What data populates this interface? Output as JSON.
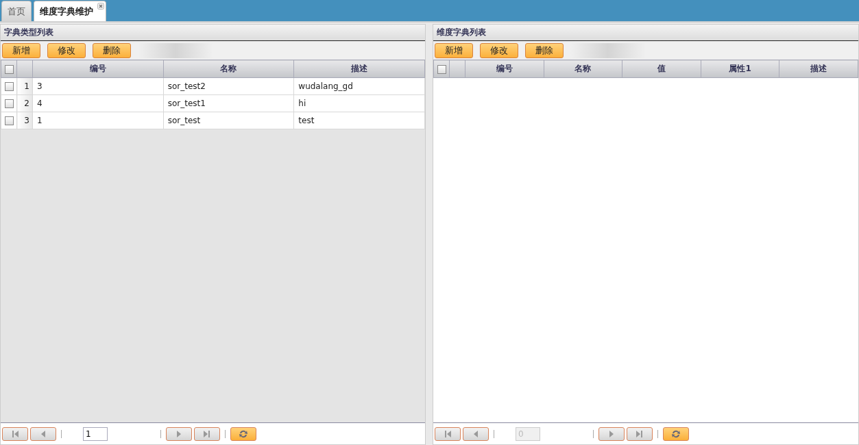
{
  "tabs": [
    {
      "label": "首页",
      "selected": false,
      "closable": false
    },
    {
      "label": "维度字典维护",
      "selected": true,
      "closable": true
    }
  ],
  "panels": [
    {
      "title": "字典类型列表",
      "buttons": [
        "新增",
        "修改",
        "删除"
      ],
      "columns": [
        "编号",
        "名称",
        "描述"
      ],
      "all_checked": false,
      "rows": [
        {
          "number": "1",
          "checked": false,
          "cells": [
            "3",
            "sor_test2",
            "wudalang_gd"
          ]
        },
        {
          "number": "2",
          "checked": false,
          "cells": [
            "4",
            "sor_test1",
            "hi"
          ]
        },
        {
          "number": "3",
          "checked": false,
          "cells": [
            "1",
            "sor_test",
            "test"
          ]
        }
      ],
      "pager": {
        "page": "1",
        "disabled": false
      }
    },
    {
      "title": "维度字典列表",
      "buttons": [
        "新增",
        "修改",
        "删除"
      ],
      "columns": [
        "编号",
        "名称",
        "值",
        "属性1",
        "描述"
      ],
      "all_checked": false,
      "pager": {
        "page": "0",
        "disabled": true
      }
    }
  ]
}
